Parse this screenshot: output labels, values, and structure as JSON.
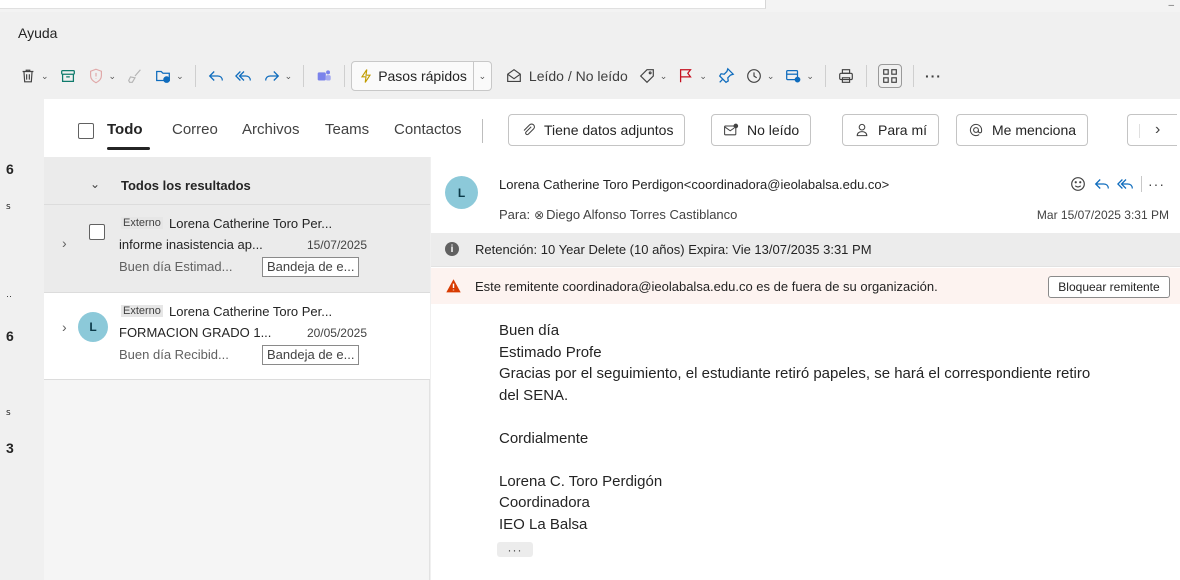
{
  "menu": {
    "help_label": "Ayuda"
  },
  "ribbon": {
    "quick_steps_label": "Pasos rápidos",
    "read_unread_label": "Leído / No leído"
  },
  "left_numbers": [
    "6",
    "6",
    "3"
  ],
  "filters": {
    "tabs": [
      {
        "label": "Todo",
        "active": true
      },
      {
        "label": "Correo"
      },
      {
        "label": "Archivos"
      },
      {
        "label": "Teams"
      },
      {
        "label": "Contactos"
      }
    ],
    "chips": [
      {
        "label": "Tiene datos adjuntos",
        "icon": "paperclip-icon"
      },
      {
        "label": "No leído",
        "icon": "mail-unread-icon"
      },
      {
        "label": "Para mí",
        "icon": "person-icon"
      },
      {
        "label": "Me menciona",
        "icon": "at-icon"
      }
    ]
  },
  "message_list": {
    "group_title": "Todos los resultados",
    "items": [
      {
        "tag": "Externo",
        "from": "Lorena Catherine Toro Per...",
        "subject": "informe inasistencia ap...",
        "date": "15/07/2025",
        "preview": "Buen día Estimad...",
        "folder": "Bandeja de e..."
      },
      {
        "avatar": "L",
        "tag": "Externo",
        "from": "Lorena Catherine Toro Per...",
        "subject": "FORMACION GRADO 1...",
        "date": "20/05/2025",
        "preview": "Buen día Recibid...",
        "folder": "Bandeja de e..."
      }
    ]
  },
  "reading": {
    "avatar": "L",
    "sender": "Lorena Catherine Toro Perdigon<coordinadora@ieolabalsa.edu.co>",
    "to_label": "Para:",
    "to_name": "Diego Alfonso Torres Castiblanco",
    "date": "Mar 15/07/2025 3:31 PM",
    "retention": "Retención: 10 Year Delete (10 años) Expira: Vie 13/07/2035 3:31 PM",
    "warning": "Este remitente coordinadora@ieolabalsa.edu.co es de fuera de su organización.",
    "block_label": "Bloquear remitente",
    "body": {
      "l1": "Buen día",
      "l2": "Estimado Profe",
      "l3": "Gracias por el seguimiento, el estudiante retiró papeles, se  hará el correspondiente retiro",
      "l4": "del SENA.",
      "l5": "Cordialmente",
      "l6": "Lorena C. Toro Perdigón",
      "l7": "Coordinadora",
      "l8": "IEO La Balsa"
    }
  },
  "colors": {
    "avatar_bg": "#8cc9d9",
    "warning_bg": "#fdf3f0",
    "warning_icon": "#d83b01",
    "teams_icon": "#7b83eb",
    "quick_steps_icon": "#c19c00",
    "flag_icon": "#c50f1f",
    "pin_icon": "#0f6cbd",
    "rules_icon": "#0f6cbd"
  }
}
